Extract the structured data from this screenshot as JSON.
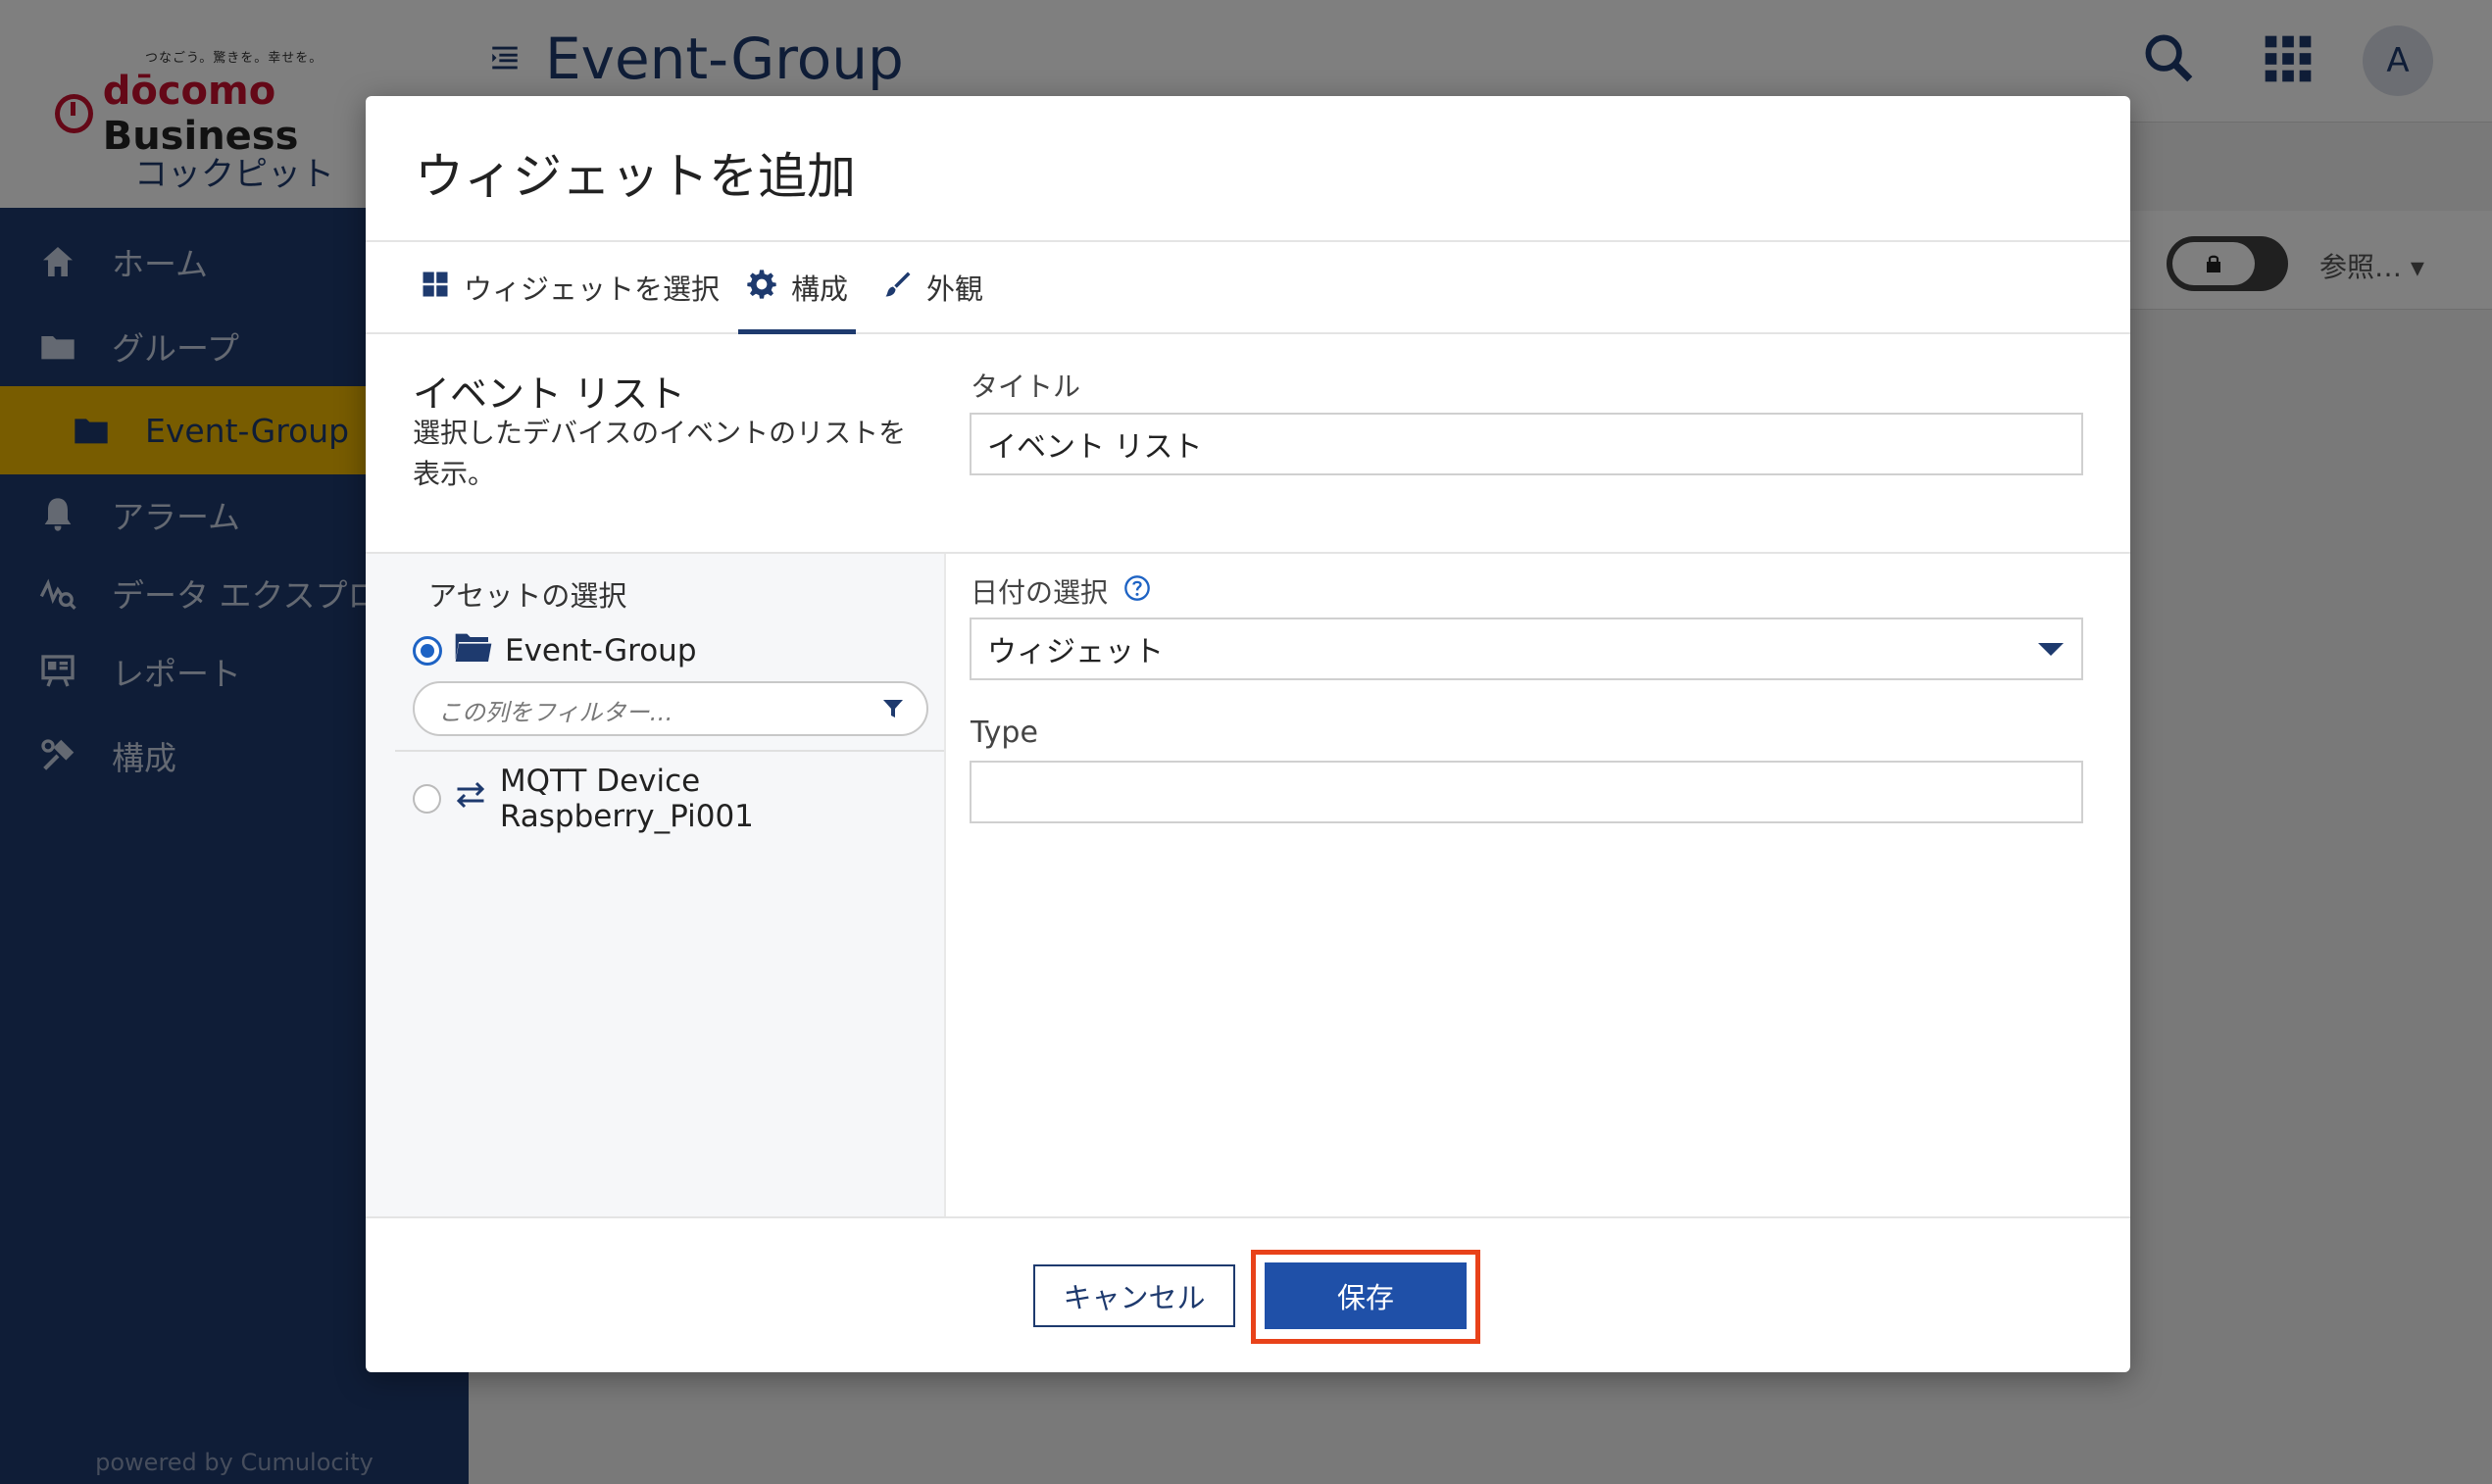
{
  "app": {
    "logo_tagline": "つなごう。驚きを。幸せを。",
    "logo_brand": "dōcomo",
    "logo_brand2": "Business",
    "cockpit_label": "コックピット",
    "powered_by": "powered by Cumulocity"
  },
  "sidebar": {
    "items": [
      {
        "label": "ホーム",
        "icon": "home-icon"
      },
      {
        "label": "グループ",
        "icon": "folder-icon"
      },
      {
        "label": "Event-Group",
        "icon": "folder-icon"
      },
      {
        "label": "アラーム",
        "icon": "bell-icon"
      },
      {
        "label": "データ エクスプロ",
        "icon": "data-explorer-icon"
      },
      {
        "label": "レポート",
        "icon": "report-icon"
      },
      {
        "label": "構成",
        "icon": "configuration-icon"
      }
    ]
  },
  "header": {
    "title": "Event-Group",
    "avatar_initial": "A",
    "browse_label": "参照…"
  },
  "modal": {
    "title": "ウィジェットを追加",
    "tabs": [
      {
        "label": "ウィジェットを選択",
        "icon": "grid-icon"
      },
      {
        "label": "構成",
        "icon": "gear-icon"
      },
      {
        "label": "外観",
        "icon": "brush-icon"
      }
    ],
    "active_tab": "構成",
    "widget_name": "イベント リスト",
    "widget_description": "選択したデバイスのイベントのリストを表示。",
    "title_label": "タイトル",
    "title_value": "イベント リスト",
    "assets": {
      "heading": "アセットの選択",
      "filter_placeholder": "この列をフィルター…",
      "items": [
        {
          "label": "Event-Group",
          "selected": true,
          "icon": "folder-open-icon"
        },
        {
          "label": "MQTT Device Raspberry_Pi001",
          "selected": false,
          "icon": "device-icon"
        }
      ]
    },
    "date_label": "日付の選択",
    "date_value": "ウィジェット",
    "type_label": "Type",
    "type_value": "",
    "cancel_label": "キャンセル",
    "save_label": "保存"
  },
  "colors": {
    "sidebar_bg": "#1e3a6e",
    "active_item": "#f0b800",
    "primary": "#1f50a8",
    "highlight_frame": "#e8421a",
    "brand_red": "#c8102e"
  }
}
